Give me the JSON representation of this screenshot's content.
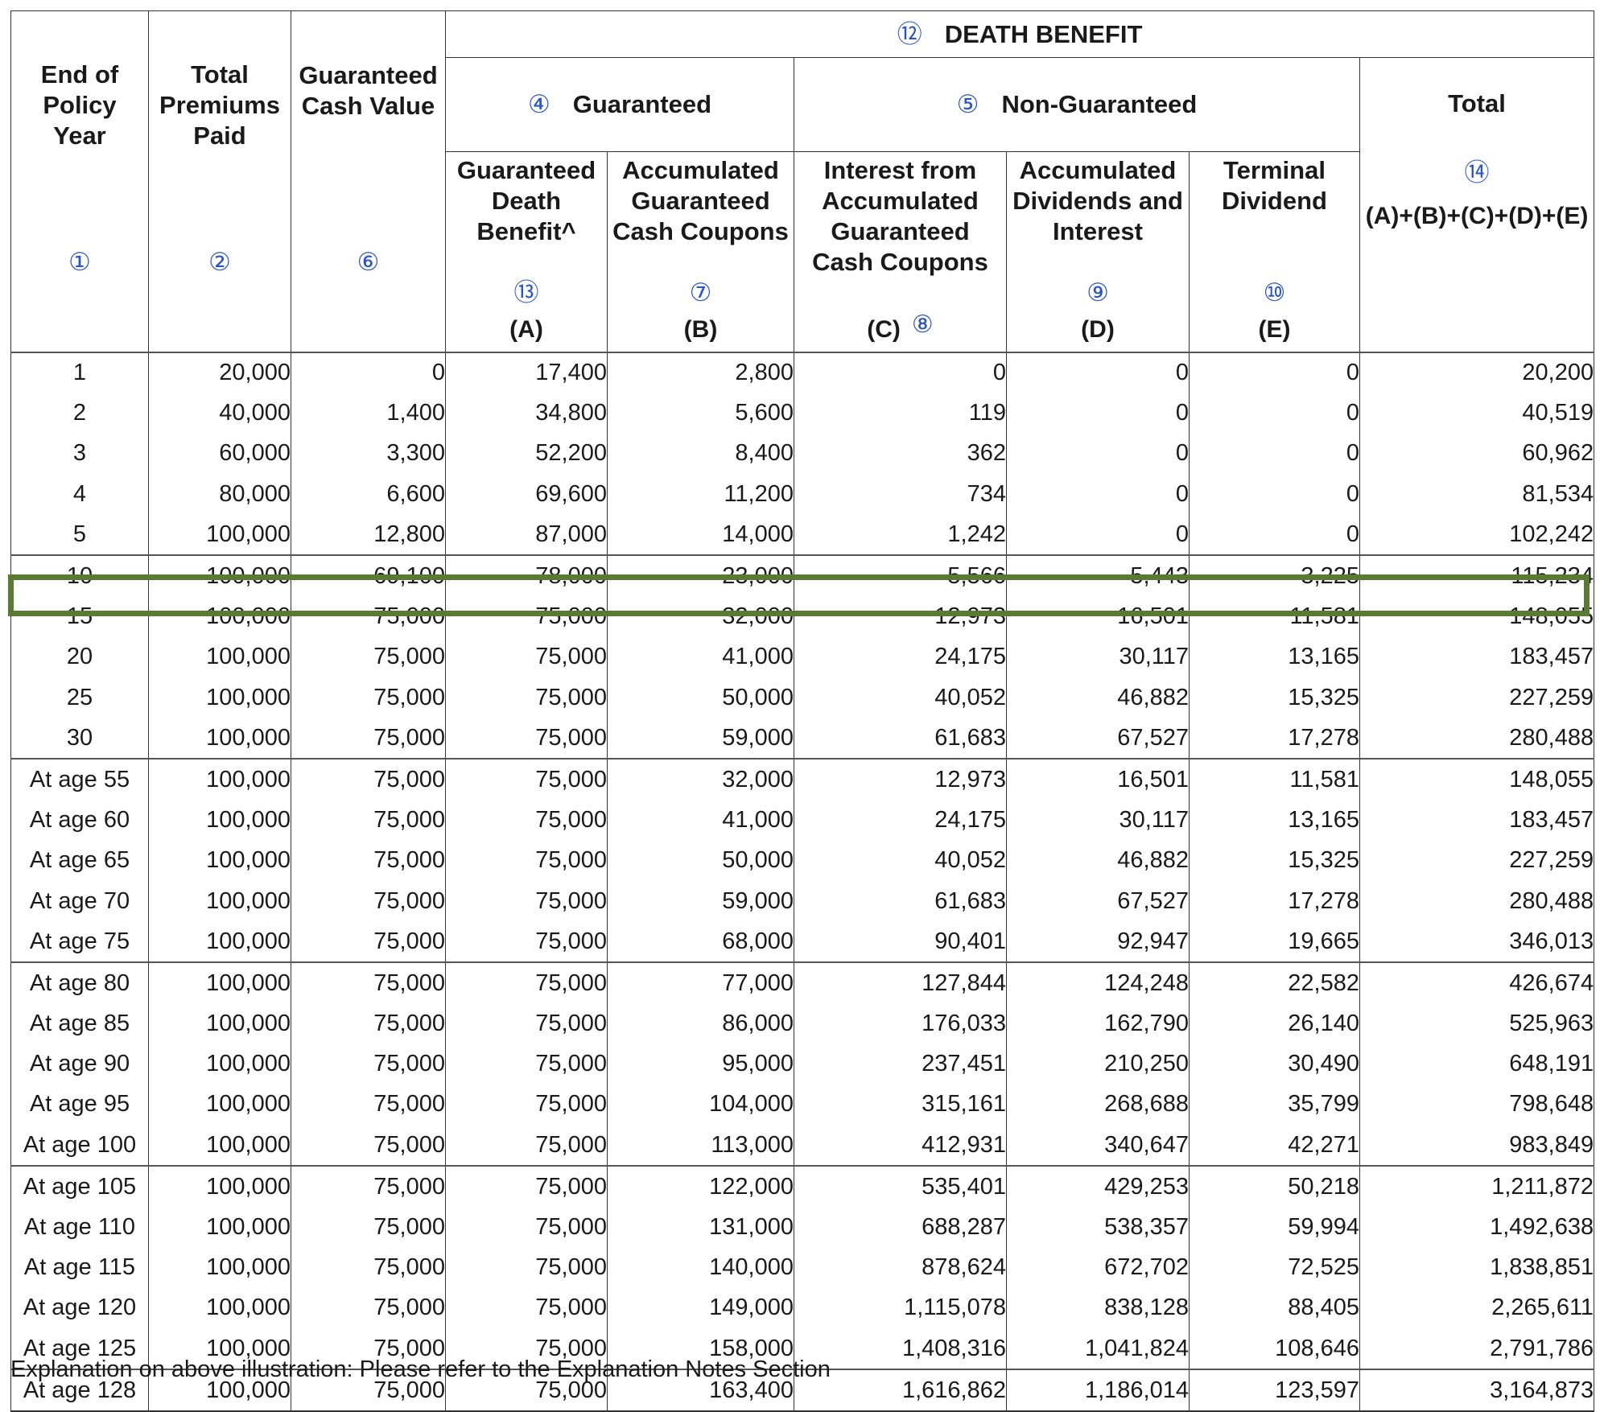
{
  "header": {
    "end_of_policy_year": "End of Policy Year",
    "total_premiums_paid": "Total Premiums Paid",
    "guaranteed_cash_value": "Guaranteed Cash Value",
    "death_benefit": "DEATH BENEFIT",
    "guaranteed": "Guaranteed",
    "non_guaranteed": "Non-Guaranteed",
    "total": "Total",
    "guaranteed_death_benefit": "Guaranteed Death Benefit^",
    "accumulated_guaranteed_cash_coupons": "Accumulated Guaranteed Cash Coupons",
    "interest_from_accumulated": "Interest from Accumulated Guaranteed Cash Coupons",
    "accumulated_dividends": "Accumulated Dividends and Interest",
    "terminal_dividend": "Terminal Dividend",
    "letters": {
      "a": "(A)",
      "b": "(B)",
      "c": "(C)",
      "d": "(D)",
      "e": "(E)",
      "total": "(A)+(B)+(C)+(D)+(E)"
    },
    "markers": {
      "year": "①",
      "premiums": "②",
      "guaranteed": "④",
      "non_guaranteed": "⑤",
      "cash_value": "⑥",
      "coupons": "⑦",
      "interest": "⑧",
      "dividends": "⑨",
      "terminal": "⑩",
      "death_benefit": "⑫",
      "gdb": "⑬",
      "total": "⑭"
    }
  },
  "rows": [
    {
      "year": "1",
      "premiums": "20,000",
      "cash_value": "0",
      "a": "17,400",
      "b": "2,800",
      "c": "0",
      "d": "0",
      "e": "0",
      "total": "20,200"
    },
    {
      "year": "2",
      "premiums": "40,000",
      "cash_value": "1,400",
      "a": "34,800",
      "b": "5,600",
      "c": "119",
      "d": "0",
      "e": "0",
      "total": "40,519"
    },
    {
      "year": "3",
      "premiums": "60,000",
      "cash_value": "3,300",
      "a": "52,200",
      "b": "8,400",
      "c": "362",
      "d": "0",
      "e": "0",
      "total": "60,962"
    },
    {
      "year": "4",
      "premiums": "80,000",
      "cash_value": "6,600",
      "a": "69,600",
      "b": "11,200",
      "c": "734",
      "d": "0",
      "e": "0",
      "total": "81,534"
    },
    {
      "year": "5",
      "premiums": "100,000",
      "cash_value": "12,800",
      "a": "87,000",
      "b": "14,000",
      "c": "1,242",
      "d": "0",
      "e": "0",
      "total": "102,242"
    },
    {
      "year": "10",
      "premiums": "100,000",
      "cash_value": "69,100",
      "a": "78,000",
      "b": "23,000",
      "c": "5,566",
      "d": "5,443",
      "e": "3,225",
      "total": "115,234"
    },
    {
      "year": "15",
      "premiums": "100,000",
      "cash_value": "75,000",
      "a": "75,000",
      "b": "32,000",
      "c": "12,973",
      "d": "16,501",
      "e": "11,581",
      "total": "148,055"
    },
    {
      "year": "20",
      "premiums": "100,000",
      "cash_value": "75,000",
      "a": "75,000",
      "b": "41,000",
      "c": "24,175",
      "d": "30,117",
      "e": "13,165",
      "total": "183,457"
    },
    {
      "year": "25",
      "premiums": "100,000",
      "cash_value": "75,000",
      "a": "75,000",
      "b": "50,000",
      "c": "40,052",
      "d": "46,882",
      "e": "15,325",
      "total": "227,259"
    },
    {
      "year": "30",
      "premiums": "100,000",
      "cash_value": "75,000",
      "a": "75,000",
      "b": "59,000",
      "c": "61,683",
      "d": "67,527",
      "e": "17,278",
      "total": "280,488"
    },
    {
      "year": "At age 55",
      "premiums": "100,000",
      "cash_value": "75,000",
      "a": "75,000",
      "b": "32,000",
      "c": "12,973",
      "d": "16,501",
      "e": "11,581",
      "total": "148,055"
    },
    {
      "year": "At age 60",
      "premiums": "100,000",
      "cash_value": "75,000",
      "a": "75,000",
      "b": "41,000",
      "c": "24,175",
      "d": "30,117",
      "e": "13,165",
      "total": "183,457"
    },
    {
      "year": "At age 65",
      "premiums": "100,000",
      "cash_value": "75,000",
      "a": "75,000",
      "b": "50,000",
      "c": "40,052",
      "d": "46,882",
      "e": "15,325",
      "total": "227,259"
    },
    {
      "year": "At age 70",
      "premiums": "100,000",
      "cash_value": "75,000",
      "a": "75,000",
      "b": "59,000",
      "c": "61,683",
      "d": "67,527",
      "e": "17,278",
      "total": "280,488"
    },
    {
      "year": "At age 75",
      "premiums": "100,000",
      "cash_value": "75,000",
      "a": "75,000",
      "b": "68,000",
      "c": "90,401",
      "d": "92,947",
      "e": "19,665",
      "total": "346,013"
    },
    {
      "year": "At age 80",
      "premiums": "100,000",
      "cash_value": "75,000",
      "a": "75,000",
      "b": "77,000",
      "c": "127,844",
      "d": "124,248",
      "e": "22,582",
      "total": "426,674"
    },
    {
      "year": "At age 85",
      "premiums": "100,000",
      "cash_value": "75,000",
      "a": "75,000",
      "b": "86,000",
      "c": "176,033",
      "d": "162,790",
      "e": "26,140",
      "total": "525,963"
    },
    {
      "year": "At age 90",
      "premiums": "100,000",
      "cash_value": "75,000",
      "a": "75,000",
      "b": "95,000",
      "c": "237,451",
      "d": "210,250",
      "e": "30,490",
      "total": "648,191"
    },
    {
      "year": "At age 95",
      "premiums": "100,000",
      "cash_value": "75,000",
      "a": "75,000",
      "b": "104,000",
      "c": "315,161",
      "d": "268,688",
      "e": "35,799",
      "total": "798,648"
    },
    {
      "year": "At age 100",
      "premiums": "100,000",
      "cash_value": "75,000",
      "a": "75,000",
      "b": "113,000",
      "c": "412,931",
      "d": "340,647",
      "e": "42,271",
      "total": "983,849"
    },
    {
      "year": "At age 105",
      "premiums": "100,000",
      "cash_value": "75,000",
      "a": "75,000",
      "b": "122,000",
      "c": "535,401",
      "d": "429,253",
      "e": "50,218",
      "total": "1,211,872"
    },
    {
      "year": "At age 110",
      "premiums": "100,000",
      "cash_value": "75,000",
      "a": "75,000",
      "b": "131,000",
      "c": "688,287",
      "d": "538,357",
      "e": "59,994",
      "total": "1,492,638"
    },
    {
      "year": "At age 115",
      "premiums": "100,000",
      "cash_value": "75,000",
      "a": "75,000",
      "b": "140,000",
      "c": "878,624",
      "d": "672,702",
      "e": "72,525",
      "total": "1,838,851"
    },
    {
      "year": "At age 120",
      "premiums": "100,000",
      "cash_value": "75,000",
      "a": "75,000",
      "b": "149,000",
      "c": "1,115,078",
      "d": "838,128",
      "e": "88,405",
      "total": "2,265,611"
    },
    {
      "year": "At age 125",
      "premiums": "100,000",
      "cash_value": "75,000",
      "a": "75,000",
      "b": "158,000",
      "c": "1,408,316",
      "d": "1,041,824",
      "e": "108,646",
      "total": "2,791,786"
    },
    {
      "year": "At age 128",
      "premiums": "100,000",
      "cash_value": "75,000",
      "a": "75,000",
      "b": "163,400",
      "c": "1,616,862",
      "d": "1,186,014",
      "e": "123,597",
      "total": "3,164,873"
    }
  ],
  "footnote": "Explanation on above illustration: Please refer to the Explanation Notes Section",
  "colors": {
    "highlight": "#5a7a34",
    "marker": "#2a55c9"
  }
}
